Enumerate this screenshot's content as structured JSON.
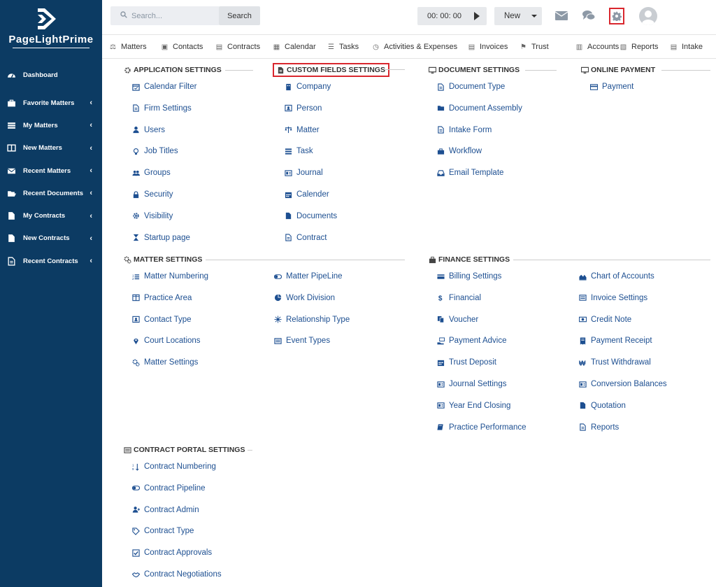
{
  "app": {
    "logo_text": "PageLightPrime"
  },
  "sidebar": {
    "items": [
      {
        "label": "Dashboard",
        "icon": "dashboard-icon",
        "chevron": false
      },
      {
        "label": "Favorite Matters",
        "icon": "briefcase-icon",
        "chevron": true
      },
      {
        "label": "My Matters",
        "icon": "list-icon",
        "chevron": true
      },
      {
        "label": "New Matters",
        "icon": "columns-icon",
        "chevron": true
      },
      {
        "label": "Recent Matters",
        "icon": "envelope-icon",
        "chevron": true
      },
      {
        "label": "Recent Documents",
        "icon": "folder-open-icon",
        "chevron": true
      },
      {
        "label": "My Contracts",
        "icon": "file-icon",
        "chevron": true
      },
      {
        "label": "New Contracts",
        "icon": "file-icon",
        "chevron": true
      },
      {
        "label": "Recent Contracts",
        "icon": "file-text-icon",
        "chevron": true
      }
    ],
    "chevron_glyph": "‹"
  },
  "topbar": {
    "search_placeholder": "Search...",
    "search_button": "Search",
    "timer": "00: 00: 00",
    "new_button": "New"
  },
  "menubar": {
    "items": [
      {
        "label": "Matters",
        "icon": "balance-icon"
      },
      {
        "label": "Contacts",
        "icon": "contact-card-icon"
      },
      {
        "label": "Contracts",
        "icon": "document-icon"
      },
      {
        "label": "Calendar",
        "icon": "calendar-icon"
      },
      {
        "label": "Tasks",
        "icon": "tasks-icon"
      },
      {
        "label": "Activities & Expenses",
        "icon": "clock-icon"
      },
      {
        "label": "Invoices",
        "icon": "invoice-icon"
      },
      {
        "label": "Trust",
        "icon": "flag-icon"
      },
      {
        "label": "Accounts",
        "icon": "bank-icon"
      },
      {
        "label": "Reports",
        "icon": "report-icon"
      },
      {
        "label": "Intake",
        "icon": "intake-icon"
      }
    ]
  },
  "sections": {
    "application": {
      "title": "APPLICATION SETTINGS",
      "items": [
        "Calendar Filter",
        "Firm Settings",
        "Users",
        "Job Titles",
        "Groups",
        "Security",
        "Visibility",
        "Startup page"
      ]
    },
    "custom_fields": {
      "title": "CUSTOM FIELDS SETTINGS",
      "items": [
        "Company",
        "Person",
        "Matter",
        "Task",
        "Journal",
        "Calender",
        "Documents",
        "Contract"
      ]
    },
    "document": {
      "title": "DOCUMENT SETTINGS",
      "items": [
        "Document Type",
        "Document Assembly",
        "Intake Form",
        "Workflow",
        "Email Template"
      ]
    },
    "online_payment": {
      "title": "ONLINE PAYMENT",
      "items": [
        "Payment"
      ]
    },
    "matter": {
      "title": "MATTER SETTINGS",
      "col1": [
        "Matter Numbering",
        "Practice Area",
        "Contact Type",
        "Court Locations",
        "Matter Settings"
      ],
      "col2": [
        "Matter PipeLine",
        "Work Division",
        "Relationship Type",
        "Event Types"
      ]
    },
    "finance": {
      "title": "FINANCE SETTINGS",
      "col1": [
        "Billing Settings",
        "Financial",
        "Voucher",
        "Payment Advice",
        "Trust Deposit",
        "Journal Settings",
        "Year End Closing",
        "Practice Performance"
      ],
      "col2": [
        "Chart of Accounts",
        "Invoice Settings",
        "Credit Note",
        "Payment Receipt",
        "Trust Withdrawal",
        "Conversion Balances",
        "Quotation",
        "Reports"
      ]
    },
    "contract_portal": {
      "title": "CONTRACT PORTAL SETTINGS",
      "items": [
        "Contract Numbering",
        "Contract Pipeline",
        "Contract Admin",
        "Contract Type",
        "Contract Approvals",
        "Contract Negotiations"
      ]
    }
  },
  "colors": {
    "sidebar": "#0c3b63",
    "link": "#1d4f91",
    "highlight": "#d9272e"
  }
}
